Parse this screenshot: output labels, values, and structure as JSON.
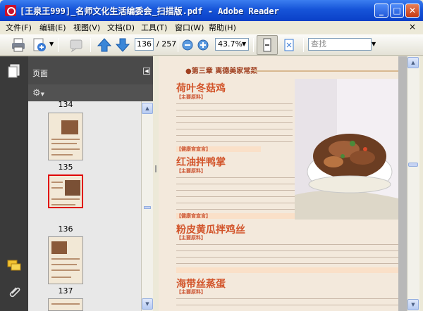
{
  "window": {
    "title": "[王泉王999]_名师文化生活编委会_扫描版.pdf - Adobe Reader",
    "minimize": "_",
    "maximize": "□",
    "close": "✕"
  },
  "menu": {
    "items": [
      "文件(F)",
      "编辑(E)",
      "视图(V)",
      "文档(D)",
      "工具(T)",
      "窗口(W)",
      "帮助(H)"
    ],
    "close_doc": "×"
  },
  "toolbar": {
    "page_current": "136",
    "page_total": "/ 257",
    "zoom": "43.7%",
    "search_placeholder": "查找"
  },
  "panel": {
    "label": "页面"
  },
  "thumbnails": [
    {
      "page": "134",
      "selected": false
    },
    {
      "page": "135",
      "selected": false
    },
    {
      "page": "136",
      "selected": true
    },
    {
      "page": "137",
      "selected": false
    }
  ],
  "document": {
    "chapter": "●第三章  离德美家常菜",
    "sections": [
      {
        "title": "荷叶冬菇鸡",
        "tag": "【主要原料】"
      },
      {
        "title": "红油拌鸭掌",
        "tag": "【主要原料】"
      },
      {
        "title": "粉皮黄瓜拌鸡丝",
        "tag": "【主要原料】"
      },
      {
        "title": "海带丝蒸蛋",
        "tag": "【主要原料】"
      }
    ],
    "tips": [
      "【健康官宣言】",
      "【健康官宣言】"
    ]
  },
  "colors": {
    "title_bar": "#1654d8",
    "selection": "#e00000",
    "heading": "#d2542a"
  }
}
